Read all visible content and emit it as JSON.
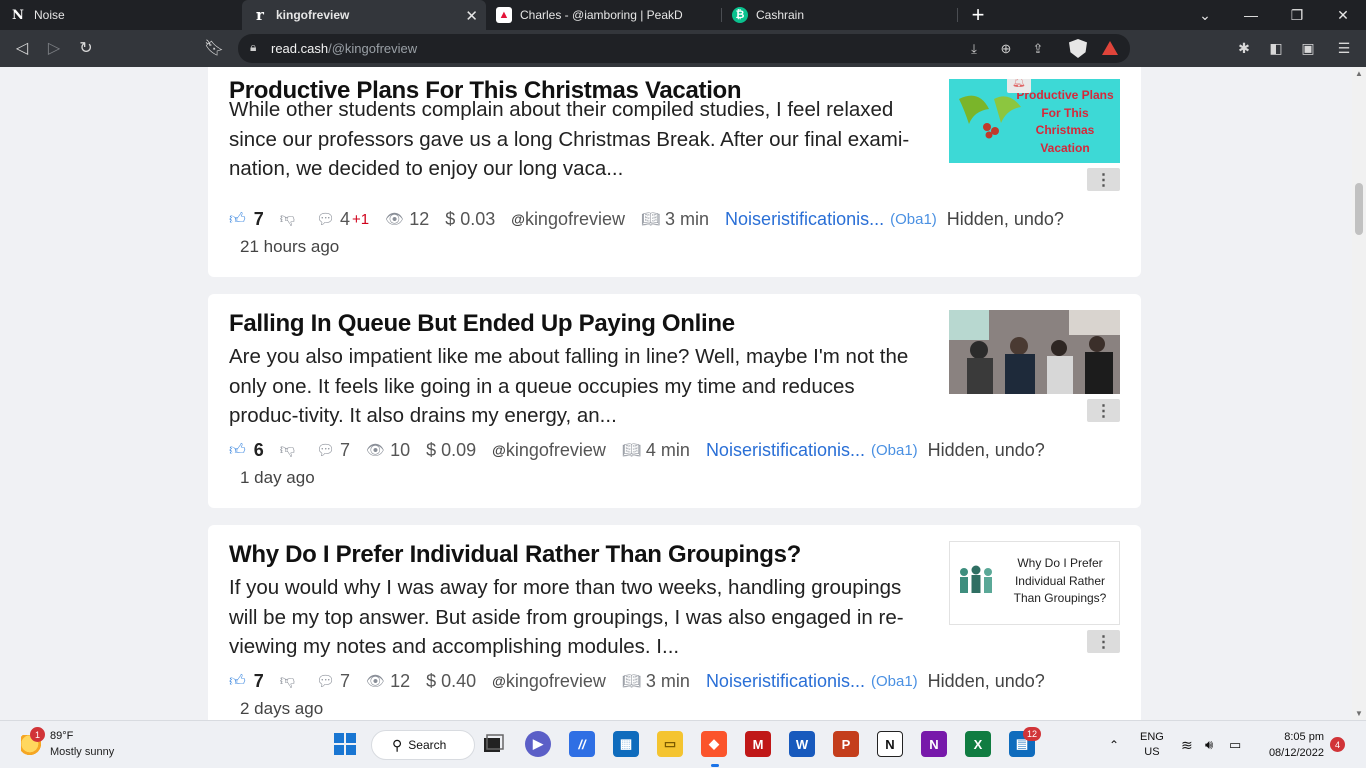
{
  "browser": {
    "tabs": [
      {
        "label": "Noise",
        "icon": "noise-favicon"
      },
      {
        "label": "kingofreview",
        "icon": "readcash-favicon",
        "active": true
      },
      {
        "label": "Charles - @iamboring | PeakD",
        "icon": "peakd-favicon"
      },
      {
        "label": "Cashrain",
        "icon": "cashrain-favicon"
      }
    ],
    "new_tab": "+",
    "url_domain": "read.cash",
    "url_path": "/@kingofreview"
  },
  "posts": [
    {
      "title": "Productive Plans For This Christmas Vacation",
      "excerpt": "While other students complain about their compiled studies, I feel relaxed since our professors gave us a long Christmas Break. After our final exami-nation, we decided to enjoy our long vaca...",
      "thumb_text": "Productive Plans For This Christmas Vacation",
      "upvotes": "7",
      "comments": "4",
      "comments_new": "+1",
      "views": "12",
      "earnings": "$ 0.03",
      "author": "kingofreview",
      "read_time": "3 min",
      "community": "Noiseristificationis...",
      "community_short": "(Oba1)",
      "hidden": "Hidden, undo?",
      "time": "21 hours ago"
    },
    {
      "title": "Falling In Queue But Ended Up Paying Online",
      "excerpt": "Are you also impatient like me about falling in line? Well, maybe I'm not the only one. It feels like going in a queue occupies my time and reduces produc-tivity. It also drains my energy, an...",
      "upvotes": "6",
      "comments": "7",
      "views": "10",
      "earnings": "$ 0.09",
      "author": "kingofreview",
      "read_time": "4 min",
      "community": "Noiseristificationis...",
      "community_short": "(Oba1)",
      "hidden": "Hidden, undo?",
      "time": "1 day ago"
    },
    {
      "title": "Why Do I Prefer Individual Rather Than Groupings?",
      "excerpt": "If you would why I was away for more than two weeks, handling groupings will be my top answer. But aside from groupings, I was also engaged in re-viewing my notes and accomplishing modules. I...",
      "thumb_text": "Why Do I Prefer Individual Rather Than Groupings?",
      "upvotes": "7",
      "comments": "7",
      "views": "12",
      "earnings": "$ 0.40",
      "author": "kingofreview",
      "read_time": "3 min",
      "community": "Noiseristificationis...",
      "community_short": "(Oba1)",
      "hidden": "Hidden, undo?",
      "time": "2 days ago"
    }
  ],
  "taskbar": {
    "weather_badge": "1",
    "temperature": "89°F",
    "weather": "Mostly sunny",
    "search_label": "Search",
    "explorer_badge": "12",
    "lang": "ENG",
    "region": "US",
    "time": "8:05 pm",
    "date": "08/12/2022",
    "notifications": "4"
  },
  "colors": {
    "accent_blue": "#2a6fd6",
    "upvote_blue": "#4a90e2",
    "comment_new_red": "#d0021b",
    "card_bg": "#ffffff",
    "page_bg": "#f0f1f4"
  }
}
